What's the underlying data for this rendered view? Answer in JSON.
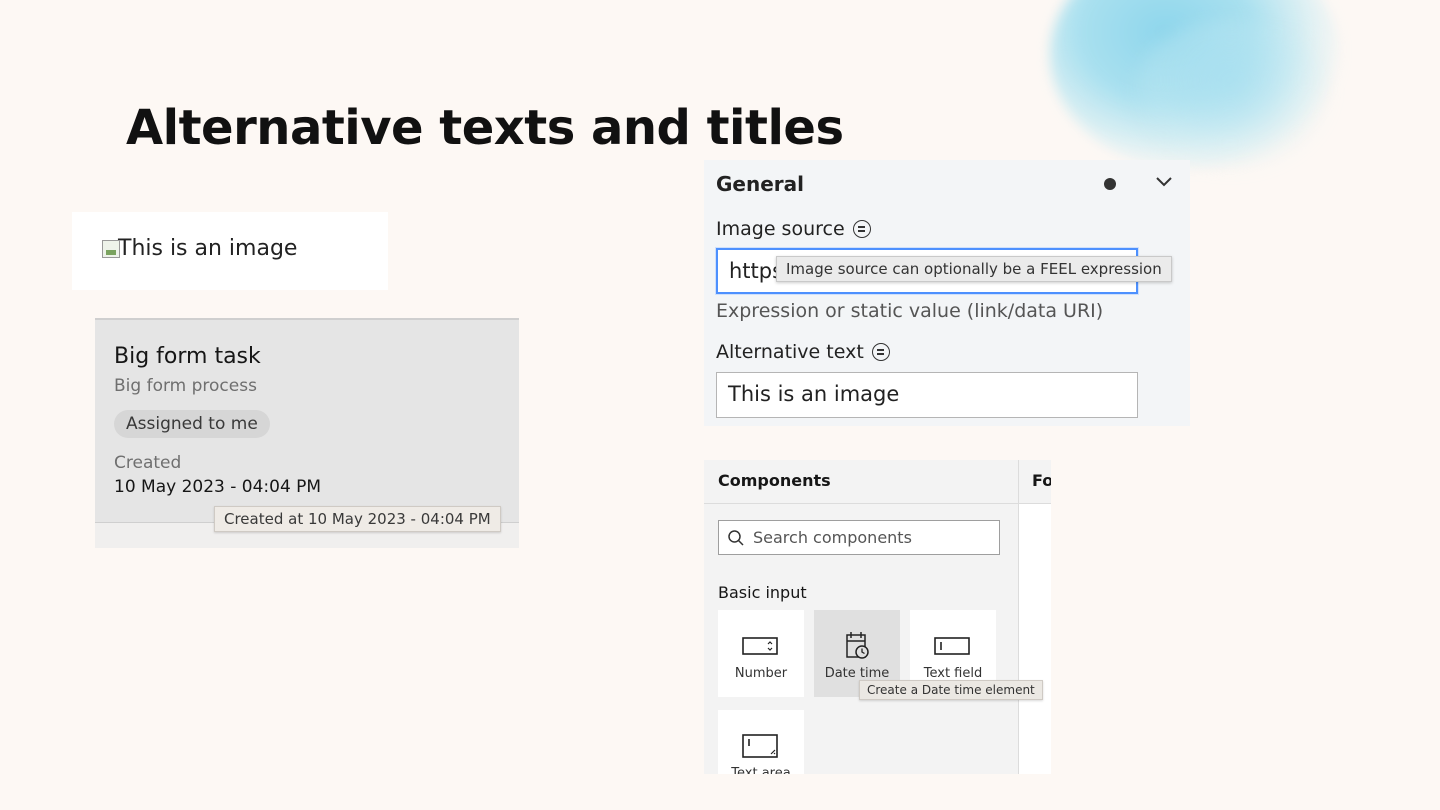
{
  "slide": {
    "title": "Alternative texts and titles"
  },
  "broken_image": {
    "alt_text": "This is an image"
  },
  "task_card": {
    "title": "Big form task",
    "process": "Big form process",
    "tag": "Assigned to me",
    "created_label": "Created",
    "created_value": "10 May 2023 - 04:04 PM",
    "tooltip": "Created at 10 May 2023 - 04:04 PM"
  },
  "properties": {
    "section_title": "General",
    "image_source_label": "Image source",
    "image_source_value": "https",
    "image_source_tooltip": "Image source can optionally be a FEEL expression",
    "image_source_hint": "Expression or static value (link/data URI)",
    "alt_text_label": "Alternative text",
    "alt_text_value": "This is an image"
  },
  "palette": {
    "title": "Components",
    "right_header": "Fo",
    "search_placeholder": "Search components",
    "section": "Basic input",
    "tiles": [
      {
        "label": "Number",
        "icon": "number-icon"
      },
      {
        "label": "Date time",
        "icon": "date-time-icon"
      },
      {
        "label": "Text field",
        "icon": "text-field-icon"
      },
      {
        "label": "Text area",
        "icon": "text-area-icon"
      }
    ],
    "tooltip": "Create a Date time element"
  }
}
